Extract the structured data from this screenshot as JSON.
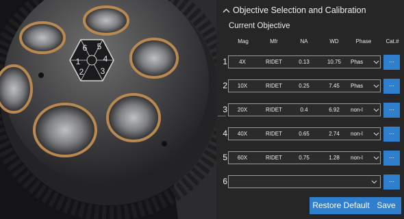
{
  "panel": {
    "title": "Objective Selection and Calibration",
    "section_label": "Current Objective"
  },
  "columns": [
    "Mag",
    "Mfr",
    "NA",
    "WD",
    "Phase",
    "Cat.#"
  ],
  "rows": [
    {
      "num": "1",
      "mag": "4X",
      "mfr": "RIDET",
      "na": "0.13",
      "wd": "10.75",
      "phase": "Phas"
    },
    {
      "num": "2",
      "mag": "10X",
      "mfr": "RIDET",
      "na": "0.25",
      "wd": "7.45",
      "phase": "Phas"
    },
    {
      "num": "3",
      "mag": "20X",
      "mfr": "RIDET",
      "na": "0.4",
      "wd": "6.92",
      "phase": "non-l"
    },
    {
      "num": "4",
      "mag": "40X",
      "mfr": "RIDET",
      "na": "0.65",
      "wd": "2.74",
      "phase": "non-l"
    },
    {
      "num": "5",
      "mag": "60X",
      "mfr": "RIDET",
      "na": "0.75",
      "wd": "1.28",
      "phase": "non-l"
    },
    {
      "num": "6",
      "mag": "",
      "mfr": "",
      "na": "",
      "wd": "",
      "phase": ""
    }
  ],
  "browse_label": "...",
  "buttons": {
    "restore": "Restore Default",
    "save": "Save"
  },
  "turret_labels": [
    "1",
    "2",
    "3",
    "4",
    "5",
    "6"
  ],
  "colors": {
    "accent": "#2f7fcc",
    "panel_bg": "#262626"
  }
}
